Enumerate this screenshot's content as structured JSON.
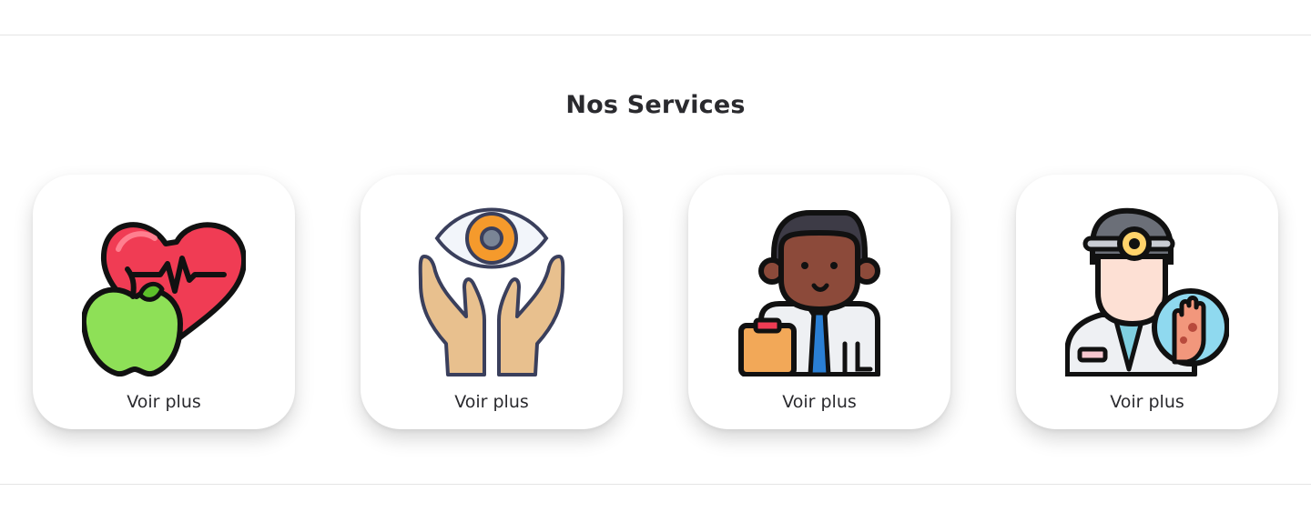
{
  "section": {
    "title": "Nos Services"
  },
  "services": [
    {
      "icon": "heart-apple-icon",
      "link_label": "Voir plus"
    },
    {
      "icon": "eye-hands-icon",
      "link_label": "Voir plus"
    },
    {
      "icon": "doctor-clipboard-icon",
      "link_label": "Voir plus"
    },
    {
      "icon": "dermatologist-icon",
      "link_label": "Voir plus"
    }
  ],
  "colors": {
    "heart": "#f03c54",
    "apple": "#8ee057",
    "iris": "#f59a2c",
    "hands": "#e8c08e",
    "skin_dark": "#8c4a3a",
    "tie": "#2a7fd4",
    "title_text": "#2a2a2e"
  }
}
